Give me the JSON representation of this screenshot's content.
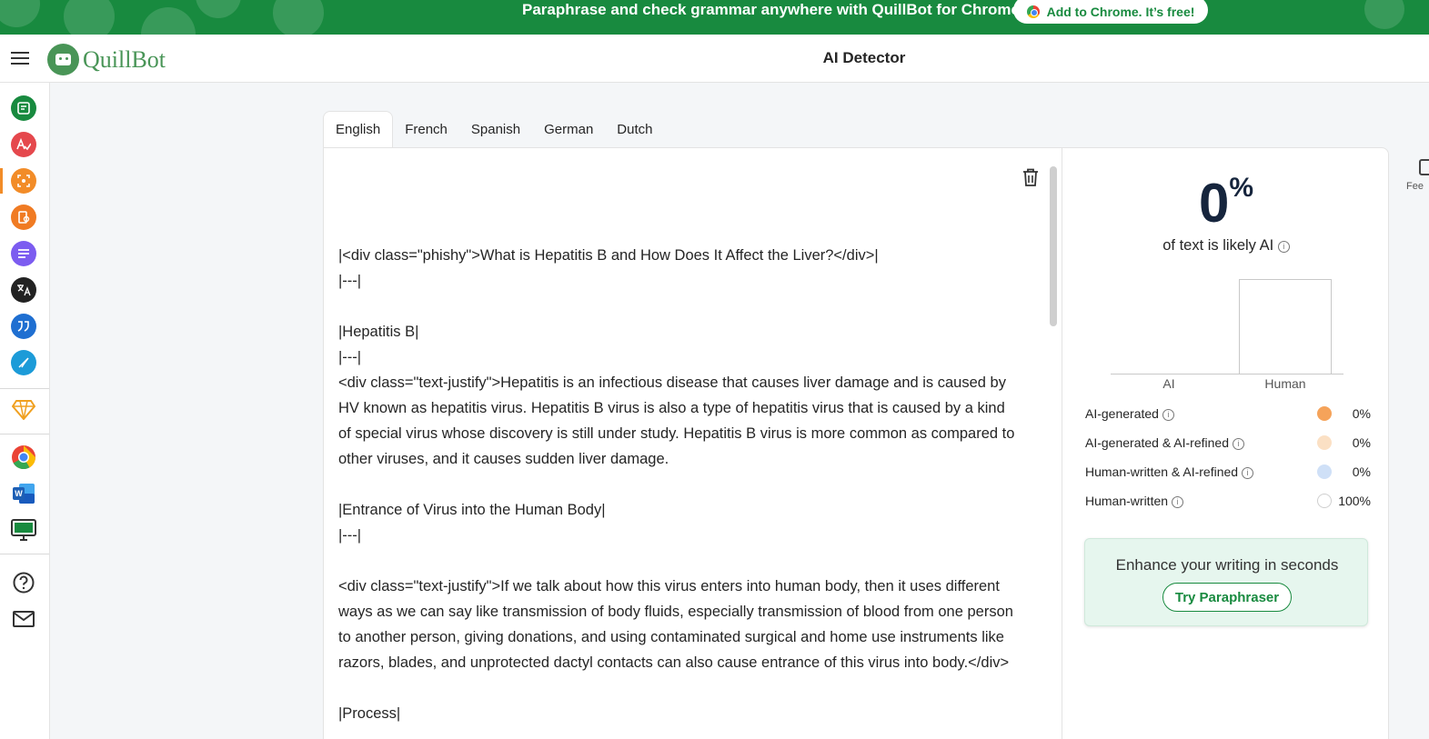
{
  "banner": {
    "text": "Paraphrase and check grammar anywhere with QuillBot for Chrome",
    "button_label": "Add to Chrome. It’s free!",
    "color": "#188a3f"
  },
  "header": {
    "logo_text": "QuillBot",
    "page_title": "AI Detector",
    "menu_icon": "hamburger-icon"
  },
  "sidebar": {
    "tools": [
      {
        "name": "paraphraser-icon",
        "color": "#188a3f"
      },
      {
        "name": "grammar-checker-icon",
        "color": "#e5484d"
      },
      {
        "name": "ai-detector-icon",
        "color": "#f28c28"
      },
      {
        "name": "plagiarism-checker-icon",
        "color": "#f07b23"
      },
      {
        "name": "summarizer-icon",
        "color": "#7c5cf0"
      },
      {
        "name": "translator-icon",
        "color": "#222222"
      },
      {
        "name": "citation-generator-icon",
        "color": "#1f6fd1"
      },
      {
        "name": "quillbot-flow-icon",
        "color": "#1c9bd8"
      },
      {
        "name": "premium-diamond-icon",
        "color": "#f0a020"
      },
      {
        "name": "chrome-extension-icon",
        "color": "#ea4335"
      },
      {
        "name": "word-addin-icon",
        "color": "#185abd"
      },
      {
        "name": "desktop-app-icon",
        "color": "#188a3f"
      }
    ],
    "help_icon": "help-icon",
    "contact_icon": "mail-icon"
  },
  "tabs": [
    "English",
    "French",
    "Spanish",
    "German",
    "Dutch"
  ],
  "editor": {
    "paragraphs": [
      "|<div class=\"phishy\">What is Hepatitis B and How Does It Affect the Liver?</div>|\n|---|",
      "|Hepatitis B|\n|---|\n<div class=\"text-justify\">Hepatitis is an infectious disease that causes liver damage and is caused by HV known as hepatitis virus. Hepatitis B virus is also a type of hepatitis virus that is caused by a kind of special virus whose discovery is still under study. Hepatitis B virus is more common as compared to other viruses, and it causes sudden liver damage.",
      "|Entrance of Virus into the Human Body|\n|---|",
      "<div class=\"text-justify\">If we talk about how this virus enters into human body, then it uses different ways as we can say like transmission of body fluids, especially transmission of blood from one person to another person, giving donations, and using contaminated surgical and home use instruments like razors, blades, and unprotected dactyl contacts can also cause entrance of this virus into body.</div>",
      "|Process|"
    ]
  },
  "results": {
    "score_value": "0",
    "score_symbol": "%",
    "likely_label": "of text is likely AI",
    "chart_data": {
      "type": "bar",
      "categories": [
        "AI",
        "Human"
      ],
      "values": [
        0,
        100
      ],
      "ylim": [
        0,
        100
      ]
    },
    "legend": [
      {
        "label": "AI-generated",
        "value": "0%",
        "color": "#f5a35a"
      },
      {
        "label": "AI-generated & AI-refined",
        "value": "0%",
        "color": "#fbe0c4"
      },
      {
        "label": "Human-written & AI-refined",
        "value": "0%",
        "color": "#cfe0f7"
      },
      {
        "label": "Human-written",
        "value": "100%",
        "color": "#ffffff"
      }
    ],
    "enhance_title": "Enhance your writing in seconds",
    "enhance_button": "Try Paraphraser"
  },
  "feedback": {
    "label": "Fee"
  }
}
